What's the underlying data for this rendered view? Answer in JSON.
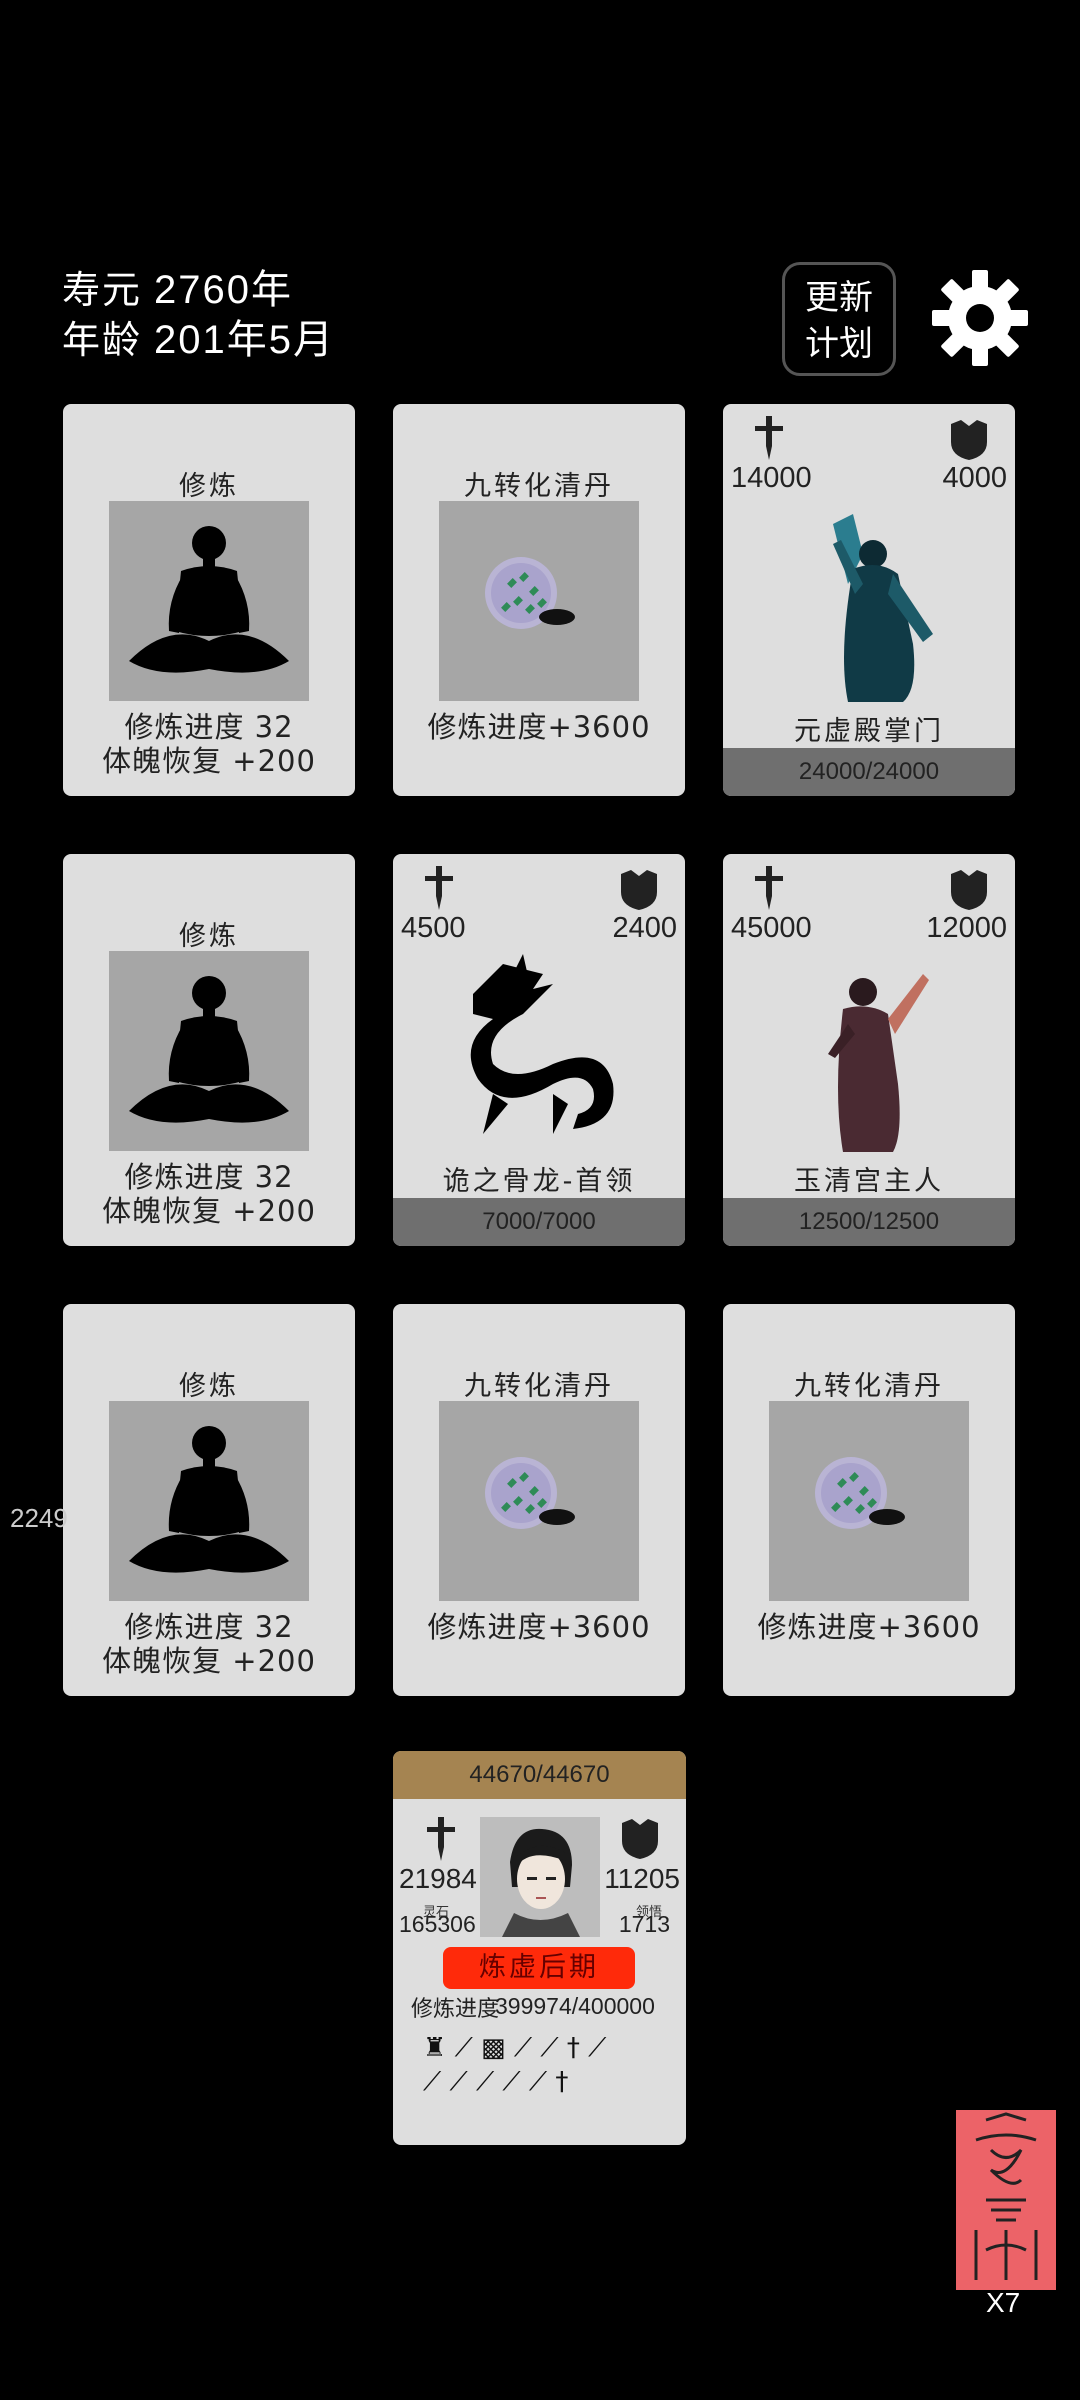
{
  "header": {
    "lifespan_label": "寿元",
    "lifespan_value": "2760年",
    "age_label": "年龄",
    "age_value": "201年5月",
    "update_plan_line1": "更新",
    "update_plan_line2": "计划",
    "settings_icon": "gear-icon"
  },
  "cards": [
    {
      "type": "cultivate",
      "title": "修炼",
      "line1": "修炼进度 32",
      "line2": "体魄恢复 +200"
    },
    {
      "type": "pill",
      "title": "九转化清丹",
      "line1": "修炼进度+3600"
    },
    {
      "type": "enemy",
      "attack": "14000",
      "defense": "4000",
      "name": "元虚殿掌门",
      "hp": "24000/24000"
    },
    {
      "type": "cultivate",
      "title": "修炼",
      "line1": "修炼进度 32",
      "line2": "体魄恢复 +200"
    },
    {
      "type": "enemy",
      "attack": "4500",
      "defense": "2400",
      "name": "诡之骨龙-首领",
      "hp": "7000/7000"
    },
    {
      "type": "enemy",
      "attack": "45000",
      "defense": "12000",
      "name": "玉清宫主人",
      "hp": "12500/12500"
    },
    {
      "type": "cultivate",
      "title": "修炼",
      "line1": "修炼进度 32",
      "line2": "体魄恢复 +200"
    },
    {
      "type": "pill",
      "title": "九转化清丹",
      "line1": "修炼进度+3600"
    },
    {
      "type": "pill",
      "title": "九转化清丹",
      "line1": "修炼进度+3600"
    }
  ],
  "side_number": "2249",
  "player": {
    "hp": "44670/44670",
    "attack": "21984",
    "defense": "11205",
    "spirit_stone_label": "灵石",
    "spirit_stone_value": "165306",
    "insight_label": "领悟",
    "insight_value": "1713",
    "realm": "炼虚后期",
    "progress_label": "修炼进度",
    "progress_value": "399974/400000"
  },
  "talisman": {
    "count": "X7"
  }
}
